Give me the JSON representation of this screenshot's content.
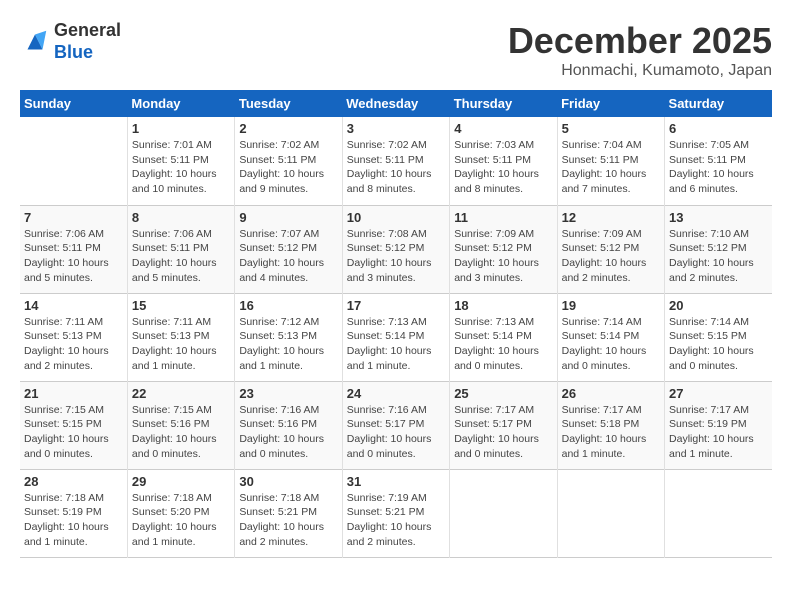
{
  "header": {
    "logo_line1": "General",
    "logo_line2": "Blue",
    "month": "December 2025",
    "location": "Honmachi, Kumamoto, Japan"
  },
  "weekdays": [
    "Sunday",
    "Monday",
    "Tuesday",
    "Wednesday",
    "Thursday",
    "Friday",
    "Saturday"
  ],
  "weeks": [
    [
      {
        "day": "",
        "info": ""
      },
      {
        "day": "1",
        "info": "Sunrise: 7:01 AM\nSunset: 5:11 PM\nDaylight: 10 hours\nand 10 minutes."
      },
      {
        "day": "2",
        "info": "Sunrise: 7:02 AM\nSunset: 5:11 PM\nDaylight: 10 hours\nand 9 minutes."
      },
      {
        "day": "3",
        "info": "Sunrise: 7:02 AM\nSunset: 5:11 PM\nDaylight: 10 hours\nand 8 minutes."
      },
      {
        "day": "4",
        "info": "Sunrise: 7:03 AM\nSunset: 5:11 PM\nDaylight: 10 hours\nand 8 minutes."
      },
      {
        "day": "5",
        "info": "Sunrise: 7:04 AM\nSunset: 5:11 PM\nDaylight: 10 hours\nand 7 minutes."
      },
      {
        "day": "6",
        "info": "Sunrise: 7:05 AM\nSunset: 5:11 PM\nDaylight: 10 hours\nand 6 minutes."
      }
    ],
    [
      {
        "day": "7",
        "info": "Sunrise: 7:06 AM\nSunset: 5:11 PM\nDaylight: 10 hours\nand 5 minutes."
      },
      {
        "day": "8",
        "info": "Sunrise: 7:06 AM\nSunset: 5:11 PM\nDaylight: 10 hours\nand 5 minutes."
      },
      {
        "day": "9",
        "info": "Sunrise: 7:07 AM\nSunset: 5:12 PM\nDaylight: 10 hours\nand 4 minutes."
      },
      {
        "day": "10",
        "info": "Sunrise: 7:08 AM\nSunset: 5:12 PM\nDaylight: 10 hours\nand 3 minutes."
      },
      {
        "day": "11",
        "info": "Sunrise: 7:09 AM\nSunset: 5:12 PM\nDaylight: 10 hours\nand 3 minutes."
      },
      {
        "day": "12",
        "info": "Sunrise: 7:09 AM\nSunset: 5:12 PM\nDaylight: 10 hours\nand 2 minutes."
      },
      {
        "day": "13",
        "info": "Sunrise: 7:10 AM\nSunset: 5:12 PM\nDaylight: 10 hours\nand 2 minutes."
      }
    ],
    [
      {
        "day": "14",
        "info": "Sunrise: 7:11 AM\nSunset: 5:13 PM\nDaylight: 10 hours\nand 2 minutes."
      },
      {
        "day": "15",
        "info": "Sunrise: 7:11 AM\nSunset: 5:13 PM\nDaylight: 10 hours\nand 1 minute."
      },
      {
        "day": "16",
        "info": "Sunrise: 7:12 AM\nSunset: 5:13 PM\nDaylight: 10 hours\nand 1 minute."
      },
      {
        "day": "17",
        "info": "Sunrise: 7:13 AM\nSunset: 5:14 PM\nDaylight: 10 hours\nand 1 minute."
      },
      {
        "day": "18",
        "info": "Sunrise: 7:13 AM\nSunset: 5:14 PM\nDaylight: 10 hours\nand 0 minutes."
      },
      {
        "day": "19",
        "info": "Sunrise: 7:14 AM\nSunset: 5:14 PM\nDaylight: 10 hours\nand 0 minutes."
      },
      {
        "day": "20",
        "info": "Sunrise: 7:14 AM\nSunset: 5:15 PM\nDaylight: 10 hours\nand 0 minutes."
      }
    ],
    [
      {
        "day": "21",
        "info": "Sunrise: 7:15 AM\nSunset: 5:15 PM\nDaylight: 10 hours\nand 0 minutes."
      },
      {
        "day": "22",
        "info": "Sunrise: 7:15 AM\nSunset: 5:16 PM\nDaylight: 10 hours\nand 0 minutes."
      },
      {
        "day": "23",
        "info": "Sunrise: 7:16 AM\nSunset: 5:16 PM\nDaylight: 10 hours\nand 0 minutes."
      },
      {
        "day": "24",
        "info": "Sunrise: 7:16 AM\nSunset: 5:17 PM\nDaylight: 10 hours\nand 0 minutes."
      },
      {
        "day": "25",
        "info": "Sunrise: 7:17 AM\nSunset: 5:17 PM\nDaylight: 10 hours\nand 0 minutes."
      },
      {
        "day": "26",
        "info": "Sunrise: 7:17 AM\nSunset: 5:18 PM\nDaylight: 10 hours\nand 1 minute."
      },
      {
        "day": "27",
        "info": "Sunrise: 7:17 AM\nSunset: 5:19 PM\nDaylight: 10 hours\nand 1 minute."
      }
    ],
    [
      {
        "day": "28",
        "info": "Sunrise: 7:18 AM\nSunset: 5:19 PM\nDaylight: 10 hours\nand 1 minute."
      },
      {
        "day": "29",
        "info": "Sunrise: 7:18 AM\nSunset: 5:20 PM\nDaylight: 10 hours\nand 1 minute."
      },
      {
        "day": "30",
        "info": "Sunrise: 7:18 AM\nSunset: 5:21 PM\nDaylight: 10 hours\nand 2 minutes."
      },
      {
        "day": "31",
        "info": "Sunrise: 7:19 AM\nSunset: 5:21 PM\nDaylight: 10 hours\nand 2 minutes."
      },
      {
        "day": "",
        "info": ""
      },
      {
        "day": "",
        "info": ""
      },
      {
        "day": "",
        "info": ""
      }
    ]
  ]
}
